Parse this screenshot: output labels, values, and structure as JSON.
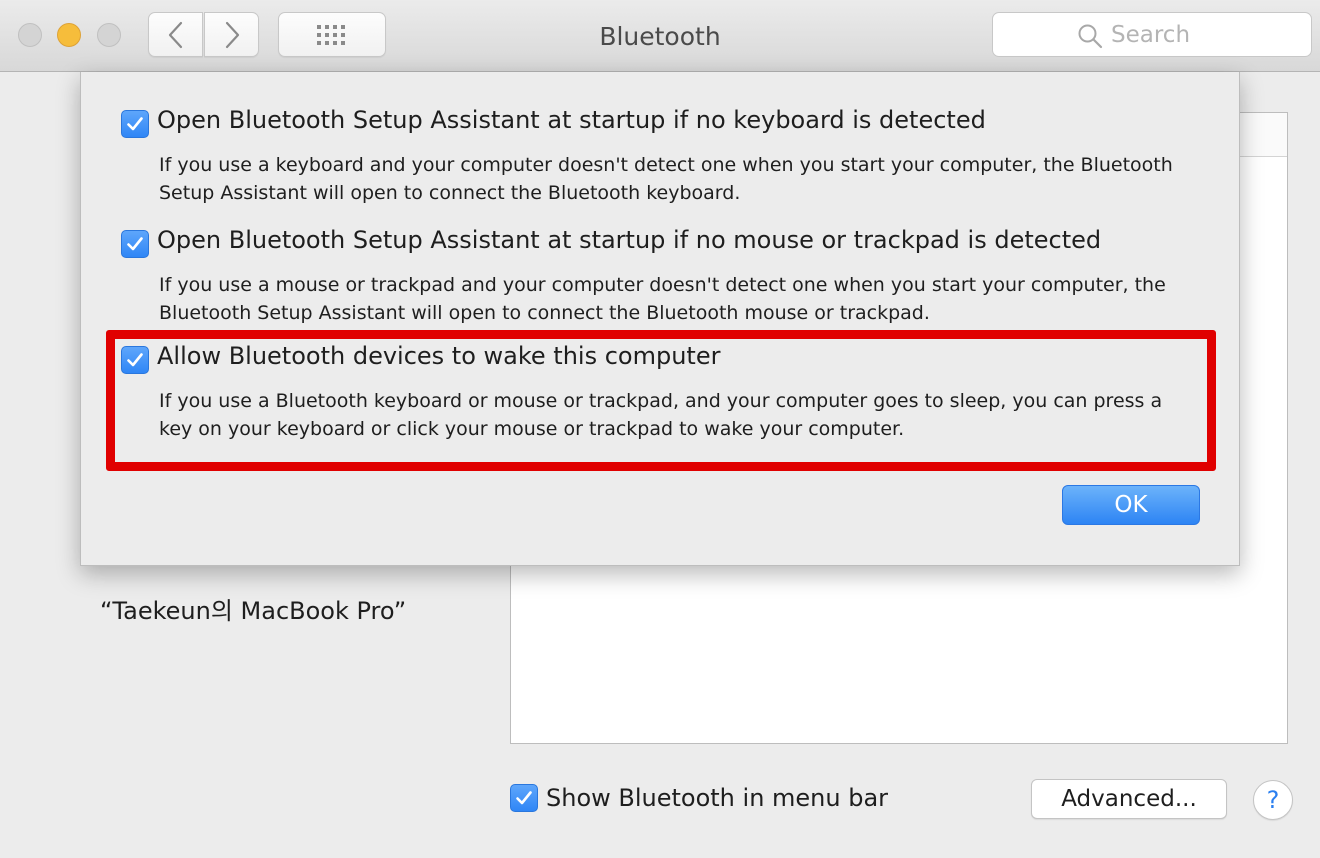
{
  "window": {
    "title": "Bluetooth"
  },
  "toolbar": {
    "search": {
      "placeholder": "Search",
      "value": ""
    }
  },
  "sheet": {
    "options": [
      {
        "checked": true,
        "label": "Open Bluetooth Setup Assistant at startup if no keyboard is detected",
        "description": "If you use a keyboard and your computer doesn't detect one when you start your computer, the Bluetooth Setup Assistant will open to connect the Bluetooth keyboard."
      },
      {
        "checked": true,
        "label": "Open Bluetooth Setup Assistant at startup if no mouse or trackpad is detected",
        "description": "If you use a mouse or trackpad and your computer doesn't detect one when you start your computer, the Bluetooth Setup Assistant will open to connect the Bluetooth mouse or trackpad."
      },
      {
        "checked": true,
        "label": "Allow Bluetooth devices to wake this computer",
        "description": "If you use a Bluetooth keyboard or mouse or trackpad, and your computer goes to sleep, you can press a key on your keyboard or click your mouse or trackpad to wake your computer."
      }
    ],
    "ok_label": "OK"
  },
  "main": {
    "device_name": "“Taekeun의 MacBook Pro”",
    "show_in_menu_bar": {
      "checked": true,
      "label": "Show Bluetooth in menu bar"
    },
    "advanced_label": "Advanced...",
    "help_label": "?"
  },
  "colors": {
    "accent": "#2f86f6",
    "highlight": "#e00000",
    "minimize": "#f6bd3b"
  }
}
